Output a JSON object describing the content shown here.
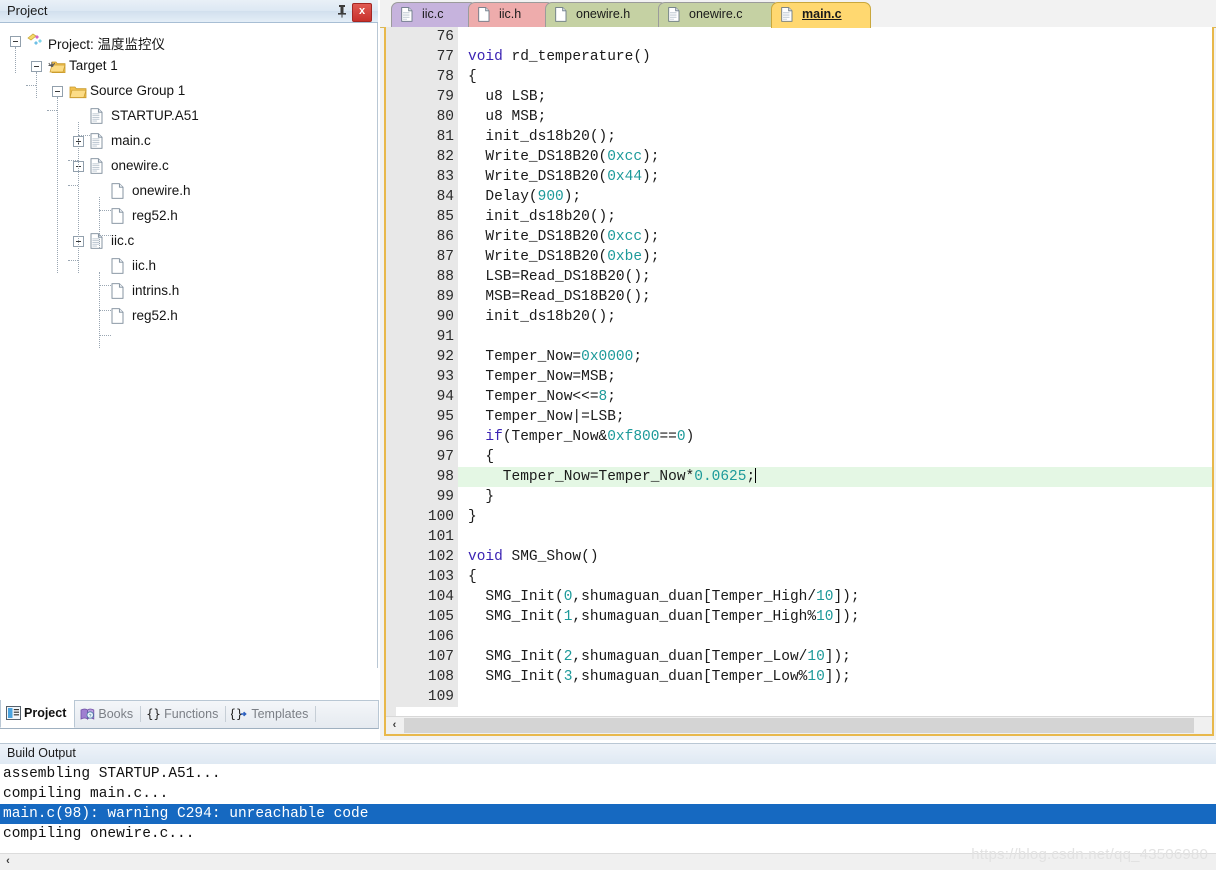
{
  "project_panel": {
    "title": "Project",
    "pin_icon": "pushpin-icon",
    "close_label": "x",
    "tree": [
      {
        "label": "Project: 温度监控仪",
        "depth": 0,
        "toggle": "minus",
        "icon": "project-icon"
      },
      {
        "label": "Target 1",
        "depth": 1,
        "toggle": "minus",
        "icon": "target-folder-icon"
      },
      {
        "label": "Source Group 1",
        "depth": 2,
        "toggle": "minus",
        "icon": "folder-icon"
      },
      {
        "label": "STARTUP.A51",
        "depth": 3,
        "toggle": "none",
        "icon": "source-file-icon"
      },
      {
        "label": "main.c",
        "depth": 3,
        "toggle": "plus",
        "icon": "source-file-icon"
      },
      {
        "label": "onewire.c",
        "depth": 3,
        "toggle": "minus",
        "icon": "source-file-icon"
      },
      {
        "label": "onewire.h",
        "depth": 4,
        "toggle": "none",
        "icon": "header-file-icon"
      },
      {
        "label": "reg52.h",
        "depth": 4,
        "toggle": "none",
        "icon": "header-file-icon"
      },
      {
        "label": "iic.c",
        "depth": 3,
        "toggle": "minus",
        "icon": "source-file-icon"
      },
      {
        "label": "iic.h",
        "depth": 4,
        "toggle": "none",
        "icon": "header-file-icon"
      },
      {
        "label": "intrins.h",
        "depth": 4,
        "toggle": "none",
        "icon": "header-file-icon"
      },
      {
        "label": "reg52.h",
        "depth": 4,
        "toggle": "none",
        "icon": "header-file-icon"
      }
    ],
    "bottom_tabs": [
      {
        "label": "Project",
        "icon": "project-window-icon",
        "active": true
      },
      {
        "label": "Books",
        "icon": "books-icon",
        "active": false
      },
      {
        "label": "Functions",
        "icon": "braces-icon",
        "active": false
      },
      {
        "label": "Templates",
        "icon": "template-icon",
        "active": false
      }
    ]
  },
  "editor": {
    "tabs": [
      {
        "label": "iic.c",
        "icon": "source-file-icon",
        "color": "#c6b3dd",
        "selected": false
      },
      {
        "label": "iic.h",
        "icon": "header-file-icon",
        "color": "#eeacac",
        "selected": false
      },
      {
        "label": "onewire.h",
        "icon": "header-file-icon",
        "color": "#c5d1a3",
        "selected": false
      },
      {
        "label": "onewire.c",
        "icon": "source-file-icon",
        "color": "#c5d1a3",
        "selected": false
      },
      {
        "label": "main.c",
        "icon": "source-file-icon",
        "color": "#ffd870",
        "selected": true
      }
    ],
    "active_line": 98,
    "scroll_left_arrow": "‹",
    "lines": [
      {
        "n": "76",
        "tokens": [
          [
            "p",
            ""
          ]
        ]
      },
      {
        "n": "77",
        "tokens": [
          [
            "k",
            "void"
          ],
          [
            "p",
            " rd_temperature()"
          ]
        ]
      },
      {
        "n": "78",
        "tokens": [
          [
            "p",
            "{"
          ]
        ]
      },
      {
        "n": "79",
        "tokens": [
          [
            "p",
            "  u8 LSB;"
          ]
        ]
      },
      {
        "n": "80",
        "tokens": [
          [
            "p",
            "  u8 MSB;"
          ]
        ]
      },
      {
        "n": "81",
        "tokens": [
          [
            "p",
            "  init_ds18b20();"
          ]
        ]
      },
      {
        "n": "82",
        "tokens": [
          [
            "p",
            "  Write_DS18B20("
          ],
          [
            "d",
            "0xcc"
          ],
          [
            "p",
            ");"
          ]
        ]
      },
      {
        "n": "83",
        "tokens": [
          [
            "p",
            "  Write_DS18B20("
          ],
          [
            "d",
            "0x44"
          ],
          [
            "p",
            ");"
          ]
        ]
      },
      {
        "n": "84",
        "tokens": [
          [
            "p",
            "  Delay("
          ],
          [
            "d",
            "900"
          ],
          [
            "p",
            ");"
          ]
        ]
      },
      {
        "n": "85",
        "tokens": [
          [
            "p",
            "  init_ds18b20();"
          ]
        ]
      },
      {
        "n": "86",
        "tokens": [
          [
            "p",
            "  Write_DS18B20("
          ],
          [
            "d",
            "0xcc"
          ],
          [
            "p",
            ");"
          ]
        ]
      },
      {
        "n": "87",
        "tokens": [
          [
            "p",
            "  Write_DS18B20("
          ],
          [
            "d",
            "0xbe"
          ],
          [
            "p",
            ");"
          ]
        ]
      },
      {
        "n": "88",
        "tokens": [
          [
            "p",
            "  LSB=Read_DS18B20();"
          ]
        ]
      },
      {
        "n": "89",
        "tokens": [
          [
            "p",
            "  MSB=Read_DS18B20();"
          ]
        ]
      },
      {
        "n": "90",
        "tokens": [
          [
            "p",
            "  init_ds18b20();"
          ]
        ]
      },
      {
        "n": "91",
        "tokens": [
          [
            "p",
            ""
          ]
        ]
      },
      {
        "n": "92",
        "tokens": [
          [
            "p",
            "  Temper_Now="
          ],
          [
            "d",
            "0x0000"
          ],
          [
            "p",
            ";"
          ]
        ]
      },
      {
        "n": "93",
        "tokens": [
          [
            "p",
            "  Temper_Now=MSB;"
          ]
        ]
      },
      {
        "n": "94",
        "tokens": [
          [
            "p",
            "  Temper_Now<<="
          ],
          [
            "d",
            "8"
          ],
          [
            "p",
            ";"
          ]
        ]
      },
      {
        "n": "95",
        "tokens": [
          [
            "p",
            "  Temper_Now|=LSB;"
          ]
        ]
      },
      {
        "n": "96",
        "tokens": [
          [
            "k",
            "  if"
          ],
          [
            "p",
            "(Temper_Now&"
          ],
          [
            "d",
            "0xf800"
          ],
          [
            "p",
            "=="
          ],
          [
            "d",
            "0"
          ],
          [
            "p",
            ")"
          ]
        ]
      },
      {
        "n": "97",
        "tokens": [
          [
            "p",
            "  {"
          ]
        ]
      },
      {
        "n": "98",
        "tokens": [
          [
            "p",
            "    Temper_Now=Temper_Now*"
          ],
          [
            "d",
            "0.0625"
          ],
          [
            "p",
            ";"
          ]
        ],
        "highlight": true,
        "marker": true,
        "caret": true
      },
      {
        "n": "99",
        "tokens": [
          [
            "p",
            "  }"
          ]
        ]
      },
      {
        "n": "100",
        "tokens": [
          [
            "p",
            "}"
          ]
        ]
      },
      {
        "n": "101",
        "tokens": [
          [
            "p",
            ""
          ]
        ]
      },
      {
        "n": "102",
        "tokens": [
          [
            "k",
            "void"
          ],
          [
            "p",
            " SMG_Show()"
          ]
        ]
      },
      {
        "n": "103",
        "tokens": [
          [
            "p",
            "{"
          ]
        ]
      },
      {
        "n": "104",
        "tokens": [
          [
            "p",
            "  SMG_Init("
          ],
          [
            "d",
            "0"
          ],
          [
            "p",
            ",shumaguan_duan[Temper_High/"
          ],
          [
            "d",
            "10"
          ],
          [
            "p",
            "]);"
          ]
        ]
      },
      {
        "n": "105",
        "tokens": [
          [
            "p",
            "  SMG_Init("
          ],
          [
            "d",
            "1"
          ],
          [
            "p",
            ",shumaguan_duan[Temper_High%"
          ],
          [
            "d",
            "10"
          ],
          [
            "p",
            "]);"
          ]
        ]
      },
      {
        "n": "106",
        "tokens": [
          [
            "p",
            ""
          ]
        ]
      },
      {
        "n": "107",
        "tokens": [
          [
            "p",
            "  SMG_Init("
          ],
          [
            "d",
            "2"
          ],
          [
            "p",
            ",shumaguan_duan[Temper_Low/"
          ],
          [
            "d",
            "10"
          ],
          [
            "p",
            "]);"
          ]
        ]
      },
      {
        "n": "108",
        "tokens": [
          [
            "p",
            "  SMG_Init("
          ],
          [
            "d",
            "3"
          ],
          [
            "p",
            ",shumaguan_duan[Temper_Low%"
          ],
          [
            "d",
            "10"
          ],
          [
            "p",
            "]);"
          ]
        ]
      },
      {
        "n": "109",
        "tokens": [
          [
            "p",
            ""
          ]
        ]
      }
    ]
  },
  "build_output": {
    "title": "Build Output",
    "scroll_left_arrow": "‹",
    "lines": [
      {
        "text": "assembling STARTUP.A51...",
        "selected": false
      },
      {
        "text": "compiling main.c...",
        "selected": false
      },
      {
        "text": "main.c(98): warning C294: unreachable code",
        "selected": true
      },
      {
        "text": "compiling onewire.c...",
        "selected": false
      }
    ]
  },
  "watermark": "https://blog.csdn.net/qq_43506980",
  "colors": {
    "selection_blue": "#1669c1",
    "highlight_green": "#e4f7e4",
    "editor_border": "#e8b84b",
    "keyword": "#3b23b3",
    "number": "#1d9a9a"
  }
}
